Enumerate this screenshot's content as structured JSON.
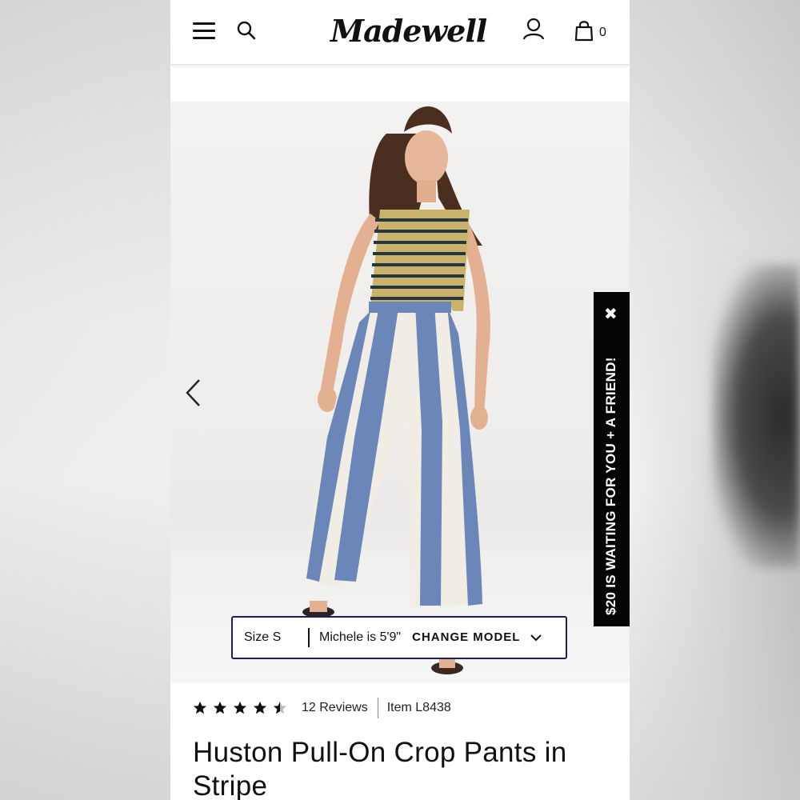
{
  "header": {
    "logo_text": "Madewell",
    "bag_count": "0"
  },
  "hero": {
    "image_desc": "Model wearing striped tank top and wide-leg blue and white striped pants",
    "model_bar": {
      "size": "Size S",
      "model_desc": "Michele is 5'9\"",
      "change_label": "CHANGE MODEL"
    }
  },
  "promo": {
    "text": "$20 IS WAITING FOR YOU + A FRIEND!",
    "close_glyph": "✖"
  },
  "product": {
    "rating": 4.5,
    "reviews": "12 Reviews",
    "item_number": "Item L8438",
    "title": "Huston Pull-On Crop Pants in Stripe"
  },
  "colors": {
    "model_bar_border": "#1d1d5a",
    "promo_bg": "#050505",
    "stripe_blue": "#6b86b8"
  }
}
